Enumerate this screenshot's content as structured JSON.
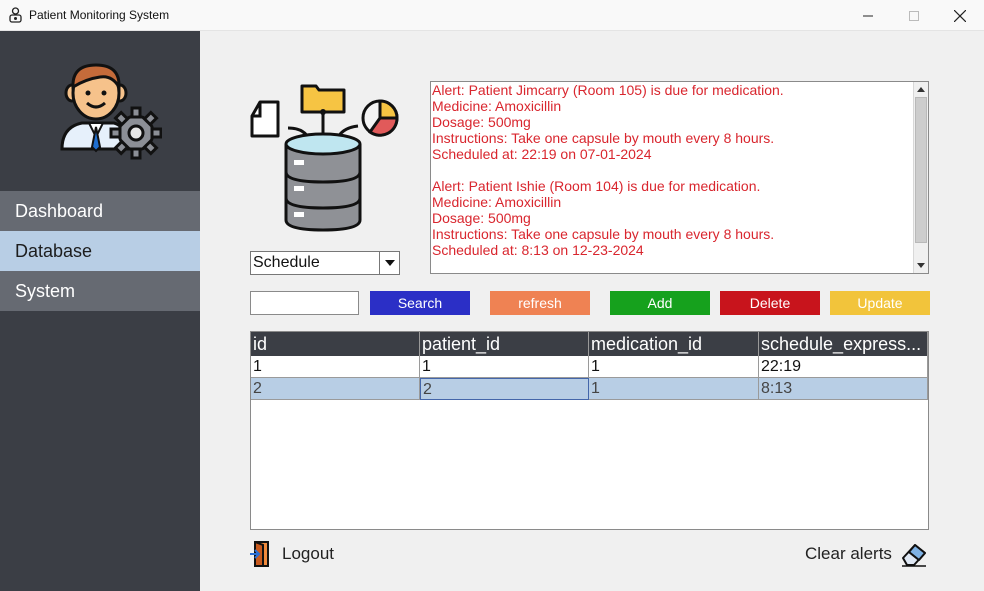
{
  "window": {
    "title": "Patient Monitoring System"
  },
  "sidebar": {
    "items": [
      {
        "label": "Dashboard",
        "selected": false
      },
      {
        "label": "Database",
        "selected": true
      },
      {
        "label": "System",
        "selected": false
      }
    ]
  },
  "table_select": {
    "value": "Schedule"
  },
  "alerts": {
    "text": "Alert: Patient Jimcarry (Room 105) is due for medication.\nMedicine: Amoxicillin\nDosage: 500mg\nInstructions: Take one capsule by mouth every 8 hours.\nScheduled at: 22:19 on 07-01-2024\n\nAlert: Patient Ishie (Room 104) is due for medication.\nMedicine: Amoxicillin\nDosage: 500mg\nInstructions: Take one capsule by mouth every 8 hours.\nScheduled at: 8:13 on 12-23-2024"
  },
  "search": {
    "value": ""
  },
  "buttons": {
    "search": "Search",
    "refresh": "refresh",
    "add": "Add",
    "delete": "Delete",
    "update": "Update"
  },
  "table": {
    "columns": [
      "id",
      "patient_id",
      "medication_id",
      "schedule_express..."
    ],
    "rows": [
      [
        "1",
        "1",
        "1",
        "22:19"
      ],
      [
        "2",
        "2",
        "1",
        "8:13"
      ]
    ]
  },
  "footer": {
    "logout": "Logout",
    "clear_alerts": "Clear alerts"
  },
  "colors": {
    "sidebar_bg": "#3b3e45",
    "nav_selected": "#b8cee5",
    "alert_text": "#d9262e",
    "search_button": "#2b2fc6",
    "refresh_button": "#ef8253",
    "add_button": "#16a11d",
    "delete_button": "#c8141c",
    "update_button": "#f2c43b"
  }
}
